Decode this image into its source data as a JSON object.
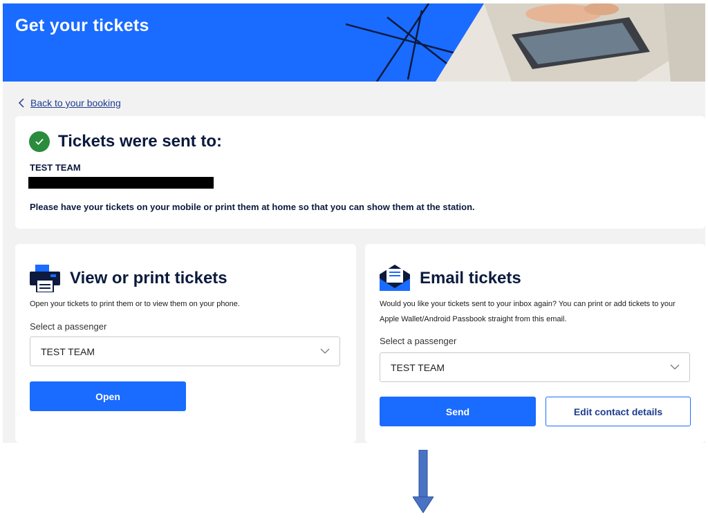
{
  "banner": {
    "title": "Get your tickets"
  },
  "back_link": {
    "label": "Back to your booking"
  },
  "sent_card": {
    "title": "Tickets were sent to:",
    "name": "TEST TEAM",
    "note": "Please have your tickets on your mobile or print them at home so that you can show them at the station."
  },
  "print_card": {
    "title": "View or print tickets",
    "description": "Open your tickets to print them or to view them on your phone.",
    "select_label": "Select a passenger",
    "selected_passenger": "TEST TEAM",
    "open_label": "Open"
  },
  "email_card": {
    "title": "Email tickets",
    "description": "Would you like your tickets sent to your inbox again? You can print or add tickets to your Apple Wallet/Android Passbook straight from this email.",
    "select_label": "Select a passenger",
    "selected_passenger": "TEST TEAM",
    "send_label": "Send",
    "edit_label": "Edit contact details"
  },
  "colors": {
    "brand_blue": "#1a6bff",
    "navy": "#0b1a3d",
    "success_green": "#2a8c3c",
    "arrow_blue": "#4a72c4"
  },
  "icons": [
    "chevron-left-icon",
    "check-circle-icon",
    "printer-icon",
    "email-icon",
    "chevron-down-icon",
    "down-arrow-icon"
  ]
}
